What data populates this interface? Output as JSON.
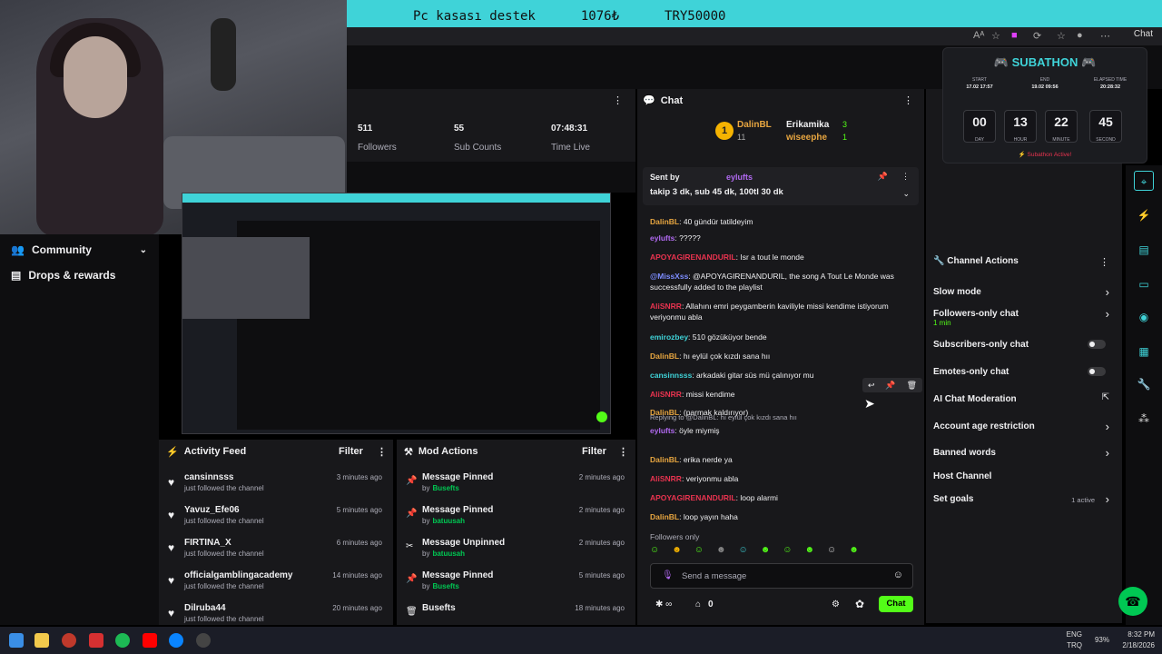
{
  "banner": {
    "item": "Pc kasası destek",
    "amount": "1076₺",
    "goal": "TRY50000"
  },
  "browser": {
    "chat_label": "Chat"
  },
  "sidebar": {
    "items": [
      {
        "label": "Community"
      },
      {
        "label": "Drops & rewards"
      }
    ]
  },
  "stats": [
    {
      "value": "511",
      "label": "Followers"
    },
    {
      "value": "55",
      "label": "Sub Counts"
    },
    {
      "value": "07:48:31",
      "label": "Time Live"
    }
  ],
  "activity": {
    "title": "Activity Feed",
    "filter": "Filter",
    "items": [
      {
        "name": "cansinnsss",
        "sub": "just followed the channel",
        "time": "3 minutes ago"
      },
      {
        "name": "Yavuz_Efe06",
        "sub": "just followed the channel",
        "time": "5 minutes ago"
      },
      {
        "name": "FIRTINA_X",
        "sub": "just followed the channel",
        "time": "6 minutes ago"
      },
      {
        "name": "officialgamblingacademy",
        "sub": "just followed the channel",
        "time": "14 minutes ago"
      },
      {
        "name": "Dilruba44",
        "sub": "just followed the channel",
        "time": "20 minutes ago"
      }
    ]
  },
  "modactions": {
    "title": "Mod Actions",
    "filter": "Filter",
    "items": [
      {
        "name": "Message Pinned",
        "by": "by",
        "user": "Busefts",
        "time": "2 minutes ago"
      },
      {
        "name": "Message Pinned",
        "by": "by",
        "user": "batuusah",
        "time": "2 minutes ago"
      },
      {
        "name": "Message Unpinned",
        "by": "by",
        "user": "batuusah",
        "time": "2 minutes ago"
      },
      {
        "name": "Message Pinned",
        "by": "by",
        "user": "Busefts",
        "time": "5 minutes ago"
      },
      {
        "name": "Busefts",
        "by": "",
        "user": "",
        "time": "18 minutes ago"
      }
    ]
  },
  "chat": {
    "title": "Chat",
    "leaders": {
      "rank": "1",
      "first": "DalinBL",
      "first_count": "11",
      "second": "Erikamika",
      "second_count": "3",
      "third": "wiseephe",
      "third_count": "1"
    },
    "pinned": {
      "sent_by": "Sent by",
      "user": "eylufts",
      "text": "takip 3 dk, sub 45 dk, 100tl 30 dk"
    },
    "messages": [
      {
        "user": "DalinBL",
        "text": "40 gündür tatildeyim",
        "color": "#e8a640"
      },
      {
        "user": "eylufts",
        "text": "?????",
        "color": "#b069f0"
      },
      {
        "user": "APOYAGIRENANDURIL",
        "text": "Isr a tout le monde",
        "color": "#e8334f"
      },
      {
        "user": "@MissXss",
        "text": "@APOYAGIRENANDURIL, the song A Tout Le Monde was successfully added to the playlist",
        "color": "#7d8dff"
      },
      {
        "user": "AliSNRR",
        "text": "Allahını emri peygamberin kaviliyle missi kendime istiyorum veriyonmu abla",
        "color": "#e8334f"
      },
      {
        "user": "emirozbey",
        "text": "510 gözüküyor bende",
        "color": "#3fd3d8"
      },
      {
        "user": "DalinBL",
        "text": "hı eylül çok kızdı sana hıı",
        "color": "#e8a640"
      },
      {
        "user": "cansinnsss",
        "text": "arkadaki gitar süs mü çalınıyor mu",
        "color": "#3fd3d8"
      },
      {
        "user": "AliSNRR",
        "text": "missi kendime",
        "color": "#e8334f"
      },
      {
        "user": "DalinBL",
        "text": "(parmak kaldırıyor)",
        "color": "#e8a640"
      },
      {
        "user": "eylufts",
        "text": "öyle miymiş",
        "color": "#b069f0",
        "reply": "Replying to @DalinBL: hı eylül çok kızdı sana hıı"
      },
      {
        "user": "DalinBL",
        "text": "erika nerde ya",
        "color": "#e8a640"
      },
      {
        "user": "AliSNRR",
        "text": "veriyonmu abla",
        "color": "#e8334f"
      },
      {
        "user": "APOYAGIRENANDURIL",
        "text": "loop alarmi",
        "color": "#e8334f"
      },
      {
        "user": "DalinBL",
        "text": "loop yayın haha",
        "color": "#e8a640"
      }
    ],
    "followers_only": "Followers only",
    "placeholder": "Send a message",
    "points": "0",
    "chat_button": "Chat"
  },
  "actions": {
    "title": "Channel Actions",
    "items": [
      {
        "label": "Slow mode"
      },
      {
        "label": "Followers-only chat",
        "sub": "1 min"
      },
      {
        "label": "Subscribers-only chat"
      },
      {
        "label": "Emotes-only chat"
      },
      {
        "label": "AI Chat Moderation"
      },
      {
        "label": "Account age restriction"
      },
      {
        "label": "Banned words"
      },
      {
        "label": "Host Channel"
      },
      {
        "label": "Set goals",
        "sub": "1 active"
      }
    ]
  },
  "subathon": {
    "title": "SUBATHON",
    "start_label": "START",
    "start": "17.02 17:57",
    "end_label": "END",
    "end": "19.02 09:56",
    "elapsed_label": "ELAPSED TIME",
    "elapsed": "20:28:32",
    "day": "00",
    "day_label": "DAY",
    "hour": "13",
    "hour_label": "HOUR",
    "minute": "22",
    "minute_label": "MINUTE",
    "second": "45",
    "second_label": "SECOND",
    "status": "Subathon Active!"
  },
  "taskbar": {
    "lang": "ENG",
    "layout": "TRQ",
    "battery": "93%",
    "time": "8:32 PM",
    "date": "2/18/2026"
  },
  "colors": {
    "accent": "#53fc18",
    "cyan": "#3fd3d8"
  }
}
